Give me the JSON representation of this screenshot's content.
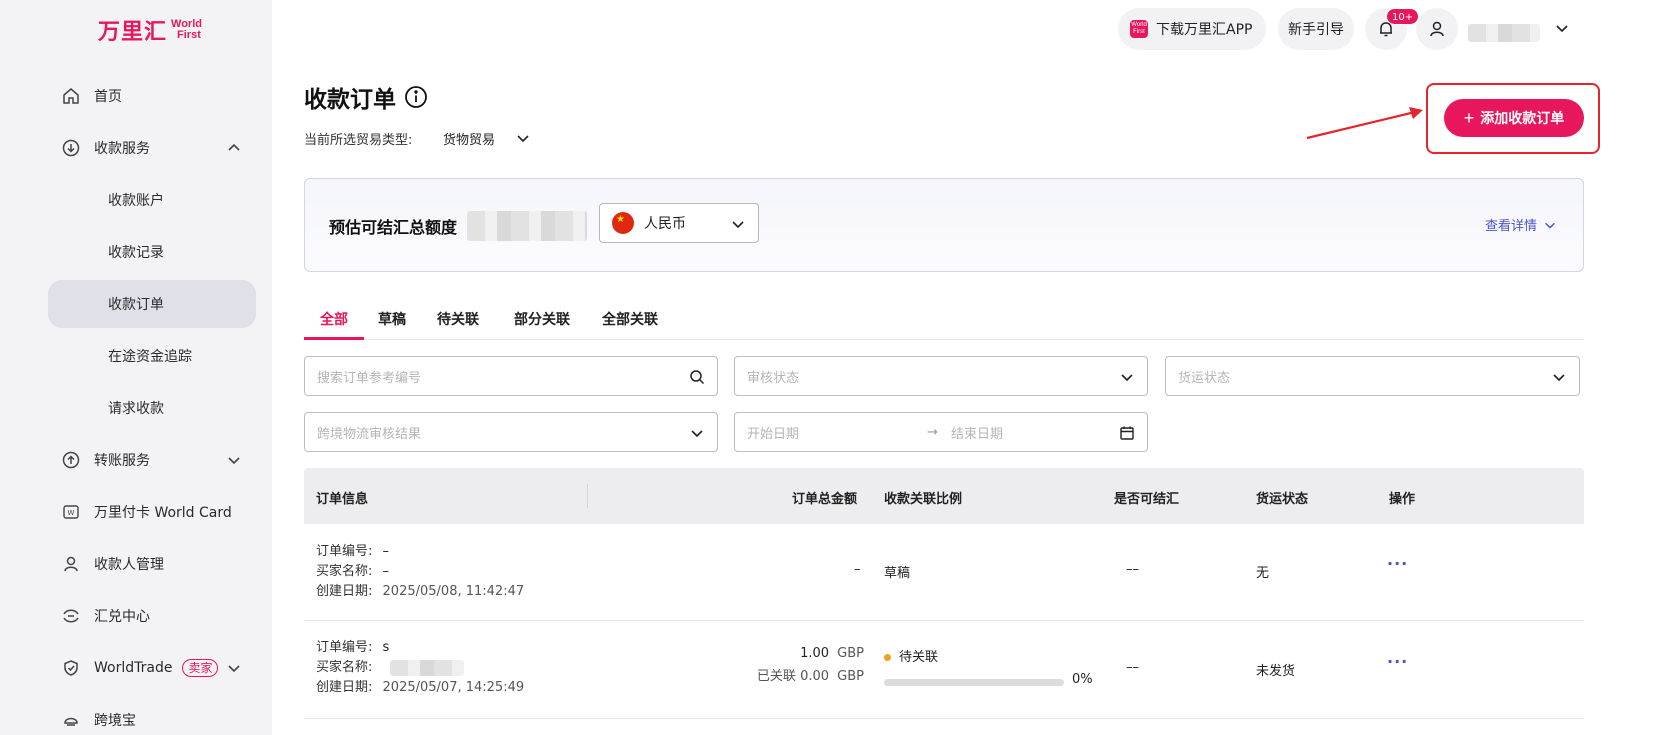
{
  "brand": {
    "cn": "万里汇",
    "en_line1": "World",
    "en_line2": "First",
    "accent": "#e8175d"
  },
  "sidebar": {
    "items": [
      {
        "label": "首页",
        "icon": "home-icon"
      },
      {
        "label": "收款服务",
        "icon": "receive-icon",
        "expanded": true
      },
      {
        "label": "转账服务",
        "icon": "transfer-icon",
        "expanded": false
      },
      {
        "label": "万里付卡 World Card",
        "icon": "card-icon"
      },
      {
        "label": "收款人管理",
        "icon": "payee-icon"
      },
      {
        "label": "汇兑中心",
        "icon": "exchange-icon"
      },
      {
        "label": "WorldTrade",
        "icon": "shield-icon",
        "badge": "卖家",
        "expanded": false
      },
      {
        "label": "跨境宝",
        "icon": "crossborder-icon"
      }
    ],
    "sub_items": [
      "收款账户",
      "收款记录",
      "收款订单",
      "在途资金追踪",
      "请求收款"
    ],
    "active_sub": "收款订单"
  },
  "topbar": {
    "download_label": "下载万里汇APP",
    "download_logo_text": "World First",
    "guide_label": "新手引导",
    "notification_count": "10+"
  },
  "header": {
    "title": "收款订单",
    "trade_type_label": "当前所选贸易类型:",
    "trade_type_value": "货物贸易",
    "add_button_label": "添加收款订单",
    "add_button_plus": "+"
  },
  "settlement": {
    "label": "预估可结汇总额度",
    "currency": "人民币",
    "view_detail": "查看详情"
  },
  "tabs": [
    "全部",
    "草稿",
    "待关联",
    "部分关联",
    "全部关联"
  ],
  "active_tab": "全部",
  "filters": {
    "search_placeholder": "搜索订单参考编号",
    "review_status": "审核状态",
    "shipping_status": "货运状态",
    "logistics_review": "跨境物流审核结果",
    "start_date": "开始日期",
    "end_date": "结束日期",
    "date_arrow": "→"
  },
  "table": {
    "columns": [
      "订单信息",
      "订单总金额",
      "收款关联比例",
      "是否可结汇",
      "货运状态",
      "操作"
    ],
    "labels": {
      "order_no": "订单编号:",
      "buyer": "买家名称:",
      "created": "创建日期:",
      "linked": "已关联"
    },
    "rows": [
      {
        "order_no": "–",
        "buyer": "–",
        "created": "2025/05/08, 11:42:47",
        "amount": "–",
        "link_status": "草稿",
        "settleable": "––",
        "shipping": "无",
        "action": "···"
      },
      {
        "order_no": "s",
        "buyer": "",
        "created": "2025/05/07, 14:25:49",
        "amount": "1.00",
        "currency": "GBP",
        "linked_amount": "0.00",
        "link_status": "待关联",
        "progress": "0%",
        "progress_fraction": 0,
        "settleable": "––",
        "shipping": "未发货",
        "action": "···"
      }
    ]
  }
}
